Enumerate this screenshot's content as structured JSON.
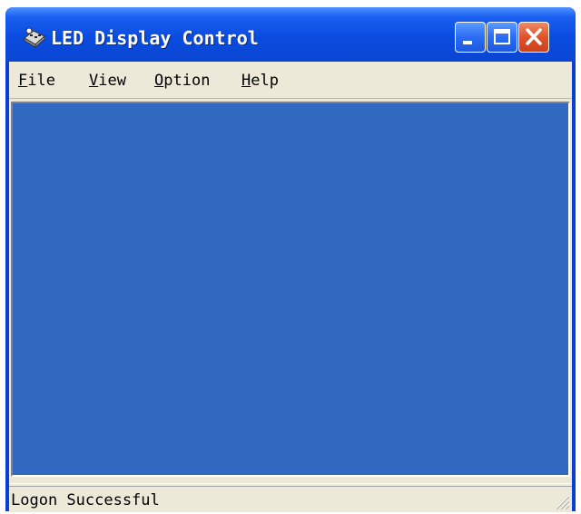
{
  "window": {
    "title": "LED Display Control",
    "icon": "led-app-icon",
    "controls": {
      "minimize": "minimize-icon",
      "maximize": "maximize-icon",
      "close": "close-icon"
    }
  },
  "menu": {
    "items": [
      {
        "mnemonic": "F",
        "rest": "ile"
      },
      {
        "mnemonic": "V",
        "rest": "iew"
      },
      {
        "mnemonic": "O",
        "rest": "ption"
      },
      {
        "mnemonic": "H",
        "rest": "elp"
      }
    ]
  },
  "workspace": {
    "background_color": "#3169C1"
  },
  "status": {
    "text": "Logon Successful"
  }
}
